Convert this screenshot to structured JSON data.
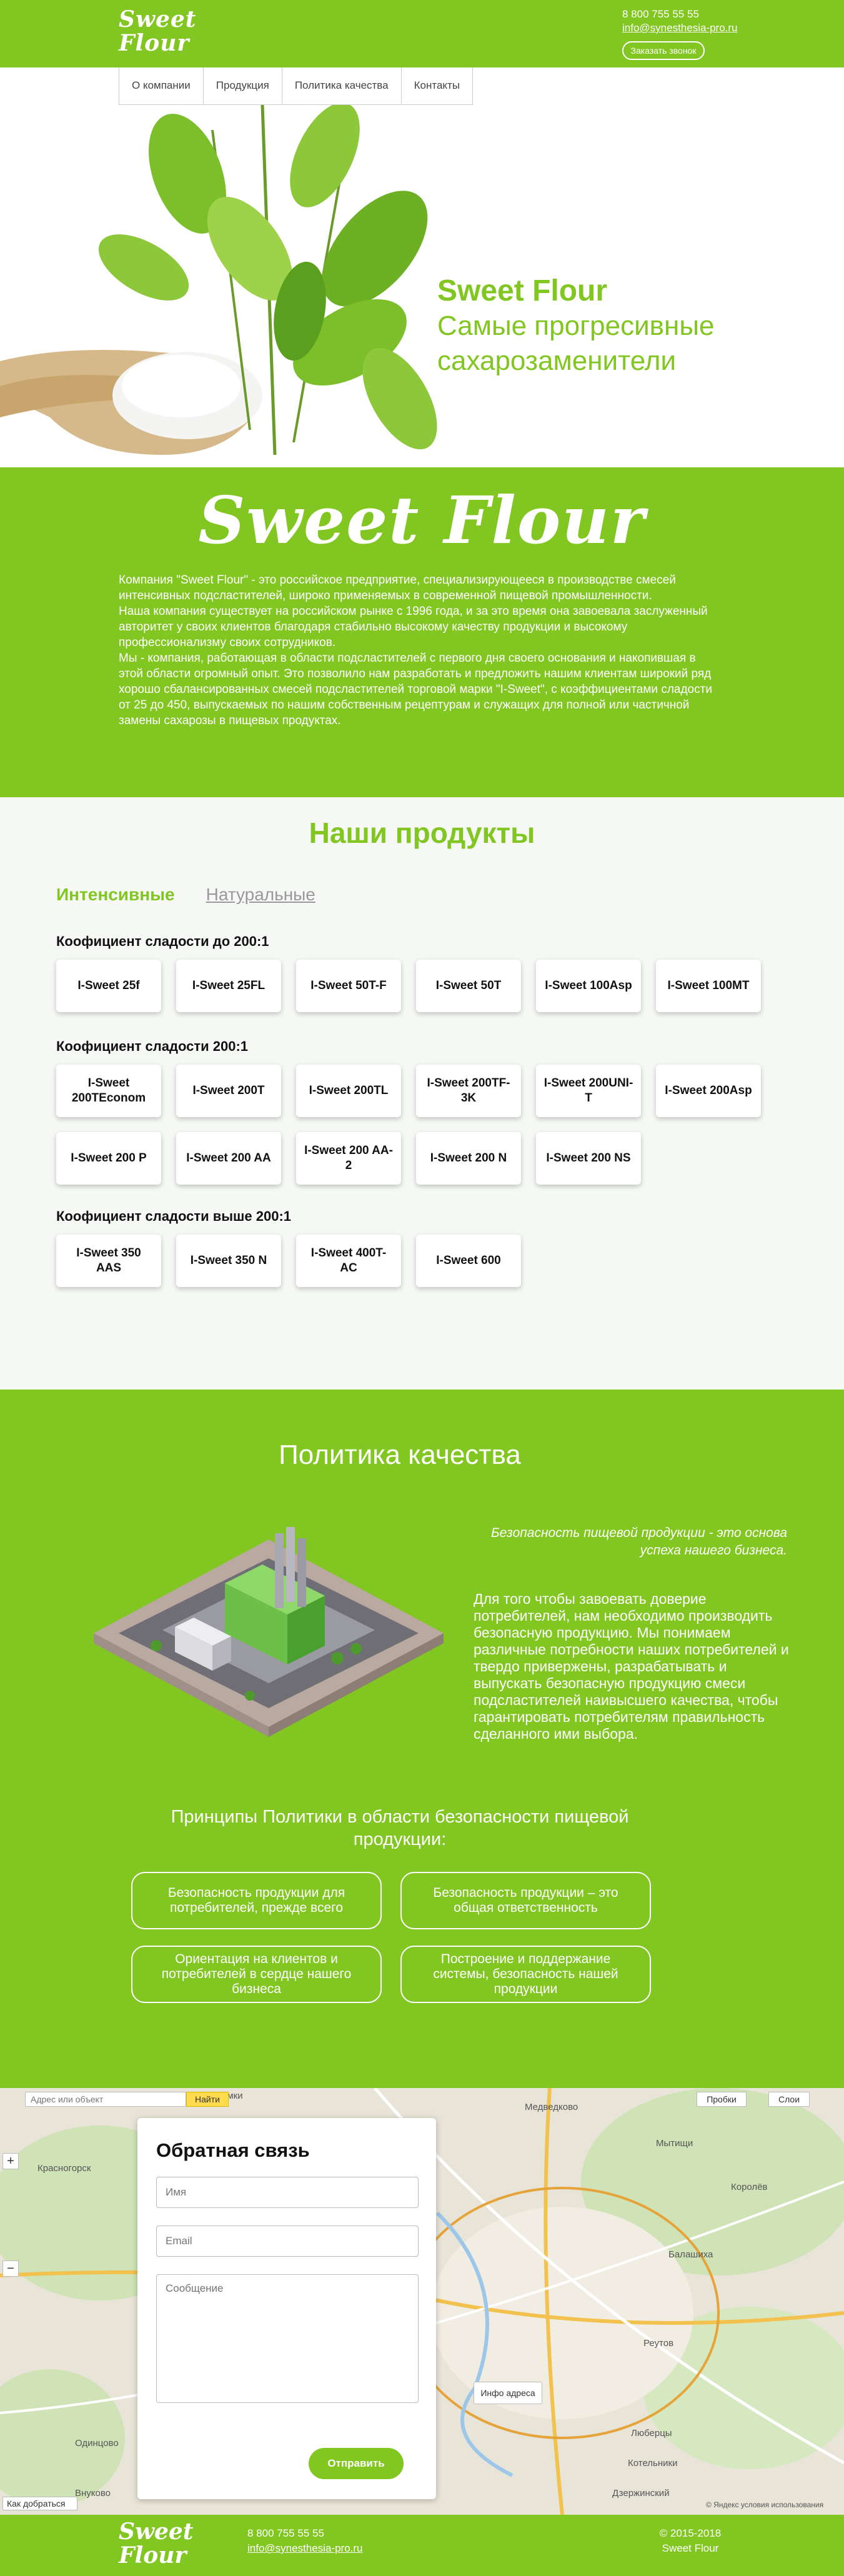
{
  "header": {
    "logo_line1": "Sweet",
    "logo_line2": "Flour",
    "phone": "8 800 755 55 55",
    "email": "info@synesthesia-pro.ru",
    "call_button": "Заказать звонок"
  },
  "nav": {
    "items": [
      "О компании",
      "Продукция",
      "Политика качества",
      "Контакты"
    ]
  },
  "hero": {
    "title": "Sweet Flour",
    "subtitle_line1": "Самые прогресивные",
    "subtitle_line2": "сахарозаменители"
  },
  "about": {
    "logo": "Sweet Flour",
    "paragraph1": "Компания \"Sweet Flour\" - это российское предприятие, специализирующееся в производстве смесей интенсивных подсластителей, широко применяемых в современной пищевой промышленности.",
    "paragraph2": "Наша компания существует на российском рынке с 1996 года, и за это время она завоевала заслуженный авторитет у своих клиентов благодаря стабильно высокому качеству продукции и высокому профессионализму своих сотрудников.",
    "paragraph3": "Мы - компания, работающая в области подсластителей с первого дня своего основания и накопившая в этой области огромный опыт. Это позволило нам разработать и предложить нашим клиентам широкий ряд хорошо сбалансированных смесей подсластителей торговой марки \"I-Sweet\", с коэффициентами сладости от 25 до 450, выпускаемых по нашим собственным рецептурам и служащих для полной или частичной замены сахарозы в пищевых продуктах."
  },
  "products": {
    "title": "Наши продукты",
    "tab_active": "Интенсивные",
    "tab_inactive": "Натуральные",
    "groups": [
      {
        "title": "Коофициент сладости до 200:1",
        "items": [
          "I-Sweet 25f",
          "I-Sweet 25FL",
          "I-Sweet 50T-F",
          "I-Sweet 50T",
          "I-Sweet 100Asp",
          "I-Sweet 100MT"
        ]
      },
      {
        "title": "Коофициент сладости 200:1",
        "items": [
          "I-Sweet 200TEconom",
          "I-Sweet 200T",
          "I-Sweet 200TL",
          "I-Sweet 200TF-3K",
          "I-Sweet 200UNI-T",
          "I-Sweet 200Asp",
          "I-Sweet 200 P",
          "I-Sweet 200 AA",
          "I-Sweet 200 AA-2",
          "I-Sweet 200 N",
          "I-Sweet 200 NS"
        ]
      },
      {
        "title": "Коофициент сладости выше 200:1",
        "items": [
          "I-Sweet 350 AAS",
          "I-Sweet 350 N",
          "I-Sweet 400T-AC",
          "I-Sweet 600"
        ]
      }
    ]
  },
  "policy": {
    "title": "Политика качества",
    "quote": "Безопасность пищевой продукции - это основа успеха нашего бизнеса.",
    "text": "Для того чтобы завоевать доверие потребителей, нам необходимо производить безопасную продукцию. Мы понимаем различные потребности наших потребителей и твердо привержены, разрабатывать и выпускать безопасную продукцию смеси подсластителей наивысшего качества, чтобы гарантировать потребителям правильность сделанного ими выбора.",
    "principles_title": "Принципы Политики в области безопасности пищевой продукции:",
    "principles": [
      "Безопасность продукции для потребителей, прежде всего",
      "Безопасность продукции – это общая ответственность",
      "Ориентация на клиентов и потребителей в сердце нашего бизнеса",
      "Построение и поддержание системы, безопасность нашей продукции"
    ]
  },
  "map": {
    "search_placeholder": "Адрес или объект",
    "find_button": "Найти",
    "traffic": "Пробки",
    "layers": "Слои",
    "info_address": "Инфо адреса",
    "route": "Как добраться",
    "copyright": "© Яндекс  условия использования",
    "labels": [
      "Химки",
      "Медведково",
      "Балашиха",
      "Реутов",
      "Люберцы",
      "Котельники",
      "Дзержинский",
      "Одинцово",
      "Внуково",
      "Красногорск",
      "Мытищи",
      "Королёв"
    ]
  },
  "feedback": {
    "title": "Обратная связь",
    "name_placeholder": "Имя",
    "email_placeholder": "Email",
    "message_placeholder": "Сообщение",
    "submit": "Отправить"
  },
  "footer": {
    "logo_line1": "Sweet",
    "logo_line2": "Flour",
    "phone": "8 800 755 55 55",
    "email": "info@synesthesia-pro.ru",
    "copyright_line1": "© 2015-2018",
    "copyright_line2": "Sweet Flour"
  },
  "colors": {
    "accent": "#82c621",
    "background": "#f6f8f5"
  }
}
